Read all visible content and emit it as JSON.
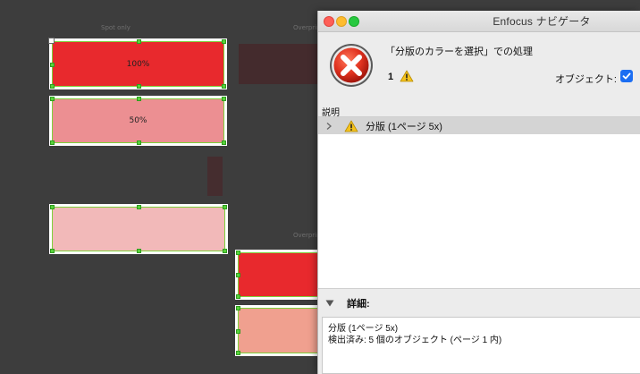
{
  "canvas": {
    "column_labels": [
      "Spot only",
      "Overprint",
      "Overprint"
    ],
    "swatches": [
      {
        "label": "100%",
        "color": "#e8292d"
      },
      {
        "label": "50%",
        "color": "#ec8f92"
      },
      {
        "label": "",
        "color": "#f2b9b9"
      },
      {
        "label": "",
        "color": "#e8292d"
      },
      {
        "label": "",
        "color": "#f0a08f"
      }
    ],
    "dark_swatches": [
      "#442b2d",
      "#452d2f"
    ]
  },
  "window": {
    "title": "Enfocus ナビゲータ",
    "heading": "「分版のカラーを選択」での処理",
    "count": "1",
    "objects_label": "オブジェクト:",
    "objects_checked": true,
    "section_label": "説明",
    "items": [
      {
        "label": "分版 (1ページ 5x)",
        "icon": "warning-icon"
      }
    ],
    "details_label": "詳細:",
    "details_lines": [
      "分版 (1ページ 5x)",
      "検出済み: 5 個のオブジェクト (ページ 1 内)"
    ],
    "colors": {
      "error_red": "#d9281f",
      "warning_yellow": "#f4c21d",
      "checkbox_blue": "#1c6ef2",
      "selection_green": "#59d33b"
    }
  }
}
